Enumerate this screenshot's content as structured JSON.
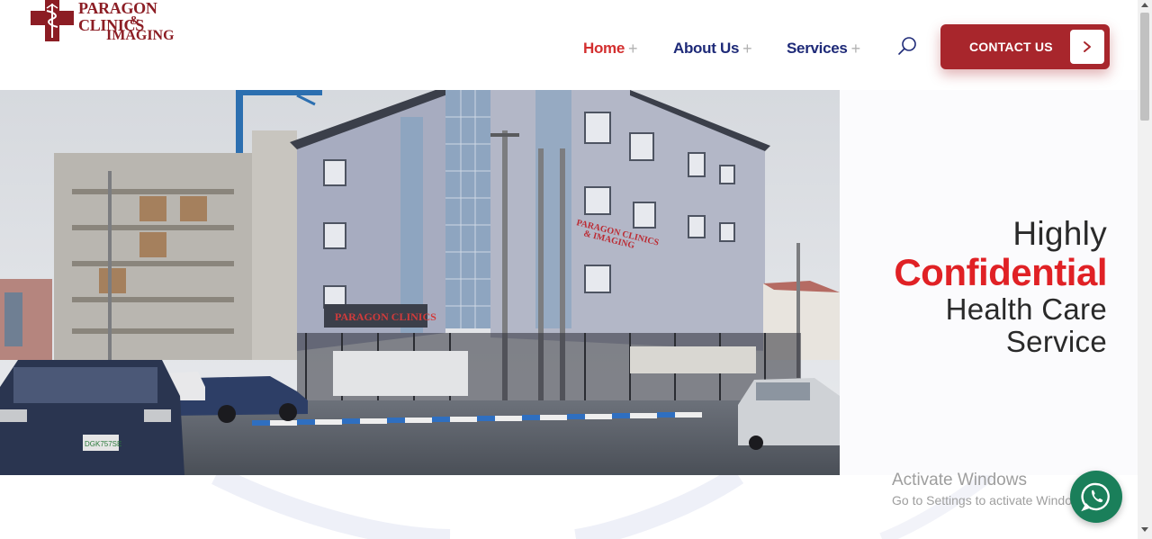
{
  "header": {
    "logo": {
      "line1": "PARAGON CLINICS",
      "line2": "&",
      "line3": "IMAGING"
    },
    "nav": [
      {
        "label": "Home",
        "active": true
      },
      {
        "label": "About Us",
        "active": false
      },
      {
        "label": "Services",
        "active": false
      }
    ],
    "nav_plus": "+",
    "search_icon": "search-icon",
    "contact_label": "CONTACT US",
    "contact_icon": "chevron-right-icon"
  },
  "hero": {
    "headline_line1": "Highly",
    "headline_line2": "Confidential",
    "headline_line3": "Health Care",
    "headline_line4": "Service",
    "photo_signs": {
      "building_sign": "PARAGON CLINICS & IMAGING",
      "entrance_sign": "PARAGON CLINICS & IMAGING",
      "car_plate": "DGK757SE"
    }
  },
  "watermark": {
    "line1": "Activate Windows",
    "line2": "Go to Settings to activate Windows."
  },
  "floating": {
    "whatsapp_icon": "whatsapp-icon"
  },
  "colors": {
    "brand_red": "#a8262c",
    "accent_red": "#e02125",
    "nav_blue": "#1e2a78",
    "whatsapp_green": "#1a7f5a"
  }
}
